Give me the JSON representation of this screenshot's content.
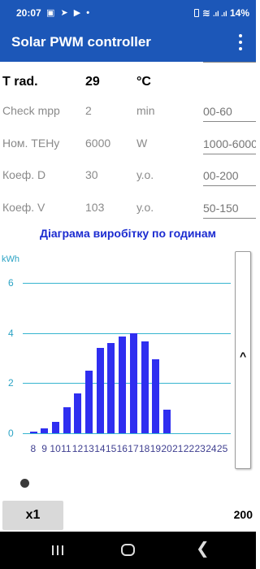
{
  "status_bar": {
    "time": "20:07",
    "left_icons": [
      "image-icon",
      "telegram-icon",
      "youtube-icon",
      "dot-icon"
    ],
    "left_icon_glyphs": "▣ ➤ ▶ •",
    "right_icons": [
      "battery-saver-icon",
      "wifi-icon",
      "signal-icon",
      "signal-icon"
    ],
    "battery": "14%"
  },
  "app_bar": {
    "title": "Solar PWM controller",
    "menu_icon": "more-vert-icon"
  },
  "params": [
    {
      "label": "T rad.",
      "value": "29",
      "unit": "°C",
      "placeholder": ""
    },
    {
      "label": "Check mpp",
      "value": "2",
      "unit": "min",
      "placeholder": "00-60"
    },
    {
      "label": "Ном. ТЕНу",
      "value": "6000",
      "unit": "W",
      "placeholder": "1000-6000"
    },
    {
      "label": "Коеф. D",
      "value": "30",
      "unit": "у.о.",
      "placeholder": "00-200"
    },
    {
      "label": "Коеф. V",
      "value": "103",
      "unit": "у.о.",
      "placeholder": "50-150"
    }
  ],
  "chart_title": "Діаграма виробітку по годинам",
  "chart_data": {
    "type": "bar",
    "title": "Діаграма виробітку по годинам",
    "ylabel": "kWh",
    "xlabel": "",
    "ylim": [
      0,
      6
    ],
    "yticks": [
      "0",
      "2",
      "4",
      "6"
    ],
    "categories": [
      "8",
      "9",
      "10",
      "11",
      "12",
      "13",
      "14",
      "15",
      "16",
      "17",
      "18",
      "19",
      "20",
      "21",
      "22",
      "23",
      "24",
      "25"
    ],
    "values": [
      0.05,
      0.2,
      0.45,
      1.05,
      1.6,
      2.5,
      3.4,
      3.6,
      3.85,
      4.0,
      3.65,
      2.95,
      0.95,
      0,
      0,
      0,
      0,
      0
    ],
    "grid": true,
    "bar_color": "#2f2ef0",
    "grid_color": "#36b5cf"
  },
  "side_panel": {
    "caret": "^"
  },
  "controls": {
    "zoom_label": "x1",
    "count": "200"
  },
  "nav": {
    "back_glyph": "❮"
  },
  "colors": {
    "brand": "#1c57b8",
    "title": "#1b2bd0",
    "axis": "#2ba3c4"
  }
}
